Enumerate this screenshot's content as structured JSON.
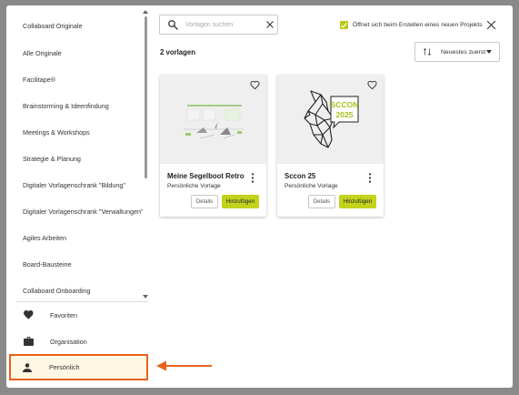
{
  "sidebar": {
    "categories": [
      "Collaboard Originale",
      "Alle Originale",
      "Facilitape®",
      "Brainstorming & Ideenfindung",
      "Meetings & Workshops",
      "Strategie & Planung",
      "Digitaler Vorlagenschrank \"Bildung\"",
      "Digitaler Vorlagenschrank \"Verwaltungen\"",
      "Agiles Arbeiten",
      "Board-Bausteine",
      "Collaboard Onboarding"
    ],
    "nav": {
      "favorites": "Favoriten",
      "organisation": "Organisation",
      "personal": "Persönlich"
    }
  },
  "search": {
    "placeholder": "Vorlagen suchen",
    "value": ""
  },
  "checkbox": {
    "label": "Öffnet sich beim Erstellen eines neuen Projekts",
    "checked": true
  },
  "results": {
    "count_label": "2 vorlagen"
  },
  "sort": {
    "label": "Neuestes zuerst"
  },
  "cards": [
    {
      "title": "Meine Segelboot Retro",
      "subtitle": "Persönliche Vorlage",
      "details_label": "Details",
      "add_label": "Hinzufügen"
    },
    {
      "title": "Sccon 25",
      "subtitle": "Persönliche Vorlage",
      "details_label": "Details",
      "add_label": "Hinzufügen",
      "badge_lines": [
        "SCCON",
        "2025"
      ]
    }
  ],
  "colors": {
    "accent": "#c3d21c",
    "highlight_border": "#e8621a",
    "highlight_bg": "#fdf7e4",
    "checkbox": "#b9c91a"
  }
}
